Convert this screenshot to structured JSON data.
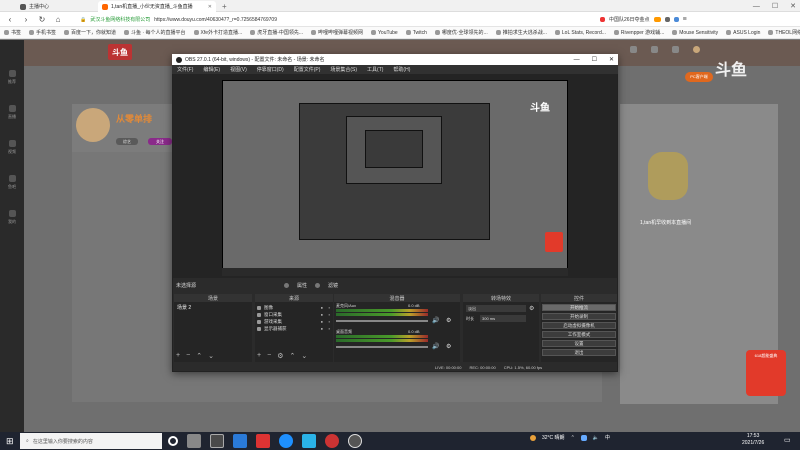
{
  "browser": {
    "tab1_label": "主播中心",
    "tab2_label": "1,tan机直播_小伙无资直播_斗鱼直播",
    "tab_add": "+",
    "win_min": "—",
    "win_max": "☐",
    "win_close": "✕",
    "company": "武汉斗鱼网络科技有限公司",
    "url": "https://www.douyu.com/4063047?_r=0.7256584769709",
    "right_text": "中国队26日夺金点",
    "bookmarks": [
      "书签",
      "手机书签",
      "百度一下，你就知道",
      "斗鱼 · 每个人的直播平台",
      "Xfe外卡打造直播...",
      "虎牙直播-中国领先...",
      "哔哩哔哩弹幕视频网",
      "YouTube",
      "Twitch",
      "哪度优·全球领先的...",
      "推拍求生大逃杀战...",
      "LoL Stats, Record...",
      "Rivenpper 游戏辅...",
      "Mouse Sensitivity",
      "ASUS Login",
      "THEOL网络教学平..."
    ]
  },
  "page": {
    "logo": "斗鱼",
    "watermark": "斗鱼",
    "streamer_name": "从零单排",
    "tag1": "综艺",
    "tag2": "关注",
    "side_text": "1,tan机早收到本直播间",
    "promo": "618超能盛典",
    "promo_small": "PC客户端",
    "nav": [
      "推荐",
      "直播",
      "视频",
      "鱼吧",
      "我的"
    ]
  },
  "obs": {
    "title": "OBS 27.0.1 (64-bit, windows) - 配置文件: 未命名 - 场景: 未命名",
    "menu": [
      "文件(F)",
      "编辑(E)",
      "视图(V)",
      "停靠窗口(D)",
      "配置文件(P)",
      "场景集合(S)",
      "工具(T)",
      "帮助(H)"
    ],
    "scene_bar": [
      "未选择源",
      "属性",
      "滤镜"
    ],
    "docks": {
      "scenes": "场景",
      "sources": "来源",
      "mixer": "混音器",
      "transitions": "转场特效",
      "controls": "控件"
    },
    "scene_item": "场景 2",
    "sources": [
      "图像",
      "窗口采集",
      "游戏采集",
      "显示器捕获"
    ],
    "mixer": [
      {
        "name": "桌面音频",
        "db": "0.0 dB"
      },
      {
        "name": "麦克风/Aux",
        "db": "0.0 dB"
      }
    ],
    "transition": "淡出",
    "duration_label": "时长",
    "duration": "300 ms",
    "controls": [
      "开始推流",
      "开始录制",
      "启动虚拟摄像机",
      "工作室模式",
      "设置",
      "退出"
    ],
    "status": [
      "LIVE: 00:00:00",
      "REC: 00:00:00",
      "CPU: 1.5%, 60.00 fps"
    ]
  },
  "taskbar": {
    "search_placeholder": "在这里输入你要搜索的内容",
    "weather": "32°C 晴朗",
    "ime": "中",
    "time": "17:53",
    "date": "2021/7/26"
  }
}
